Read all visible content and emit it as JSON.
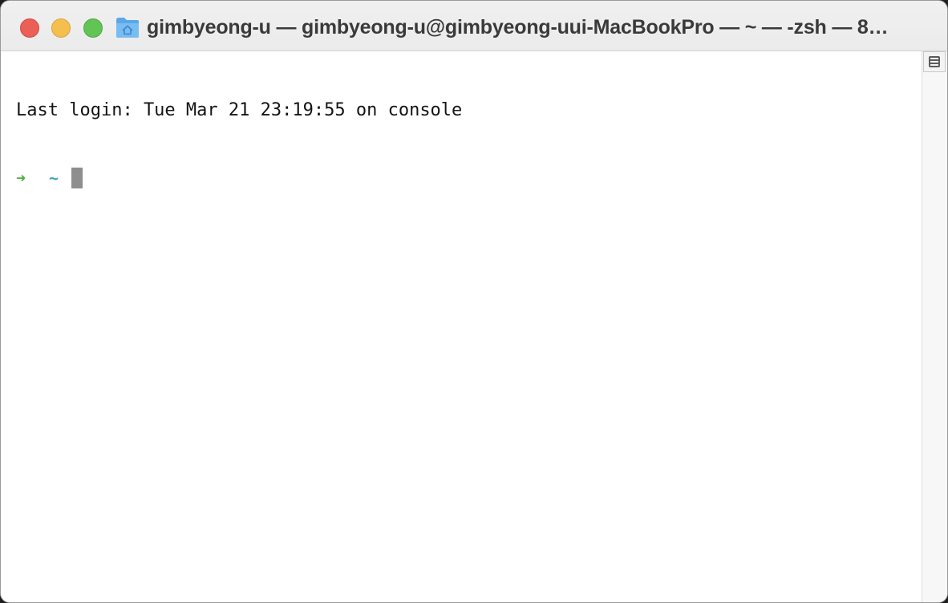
{
  "window": {
    "title": "gimbyeong-u — gimbyeong-u@gimbyeong-uui-MacBookPro — ~ — -zsh — 8…",
    "folder_icon": "home-folder-icon",
    "traffic_lights": {
      "close": "#ec5f57",
      "minimize": "#f4bf4f",
      "zoom": "#61c454"
    }
  },
  "terminal": {
    "last_login": "Last login: Tue Mar 21 23:19:55 on console",
    "prompt_arrow": "➜",
    "prompt_dir": "~",
    "prompt_arrow_color": "#4fae3c",
    "prompt_dir_color": "#3fa6b5",
    "cursor_color": "#8e8e8e"
  },
  "scrollbar": {
    "split_button_icon": "split-pane-icon"
  }
}
